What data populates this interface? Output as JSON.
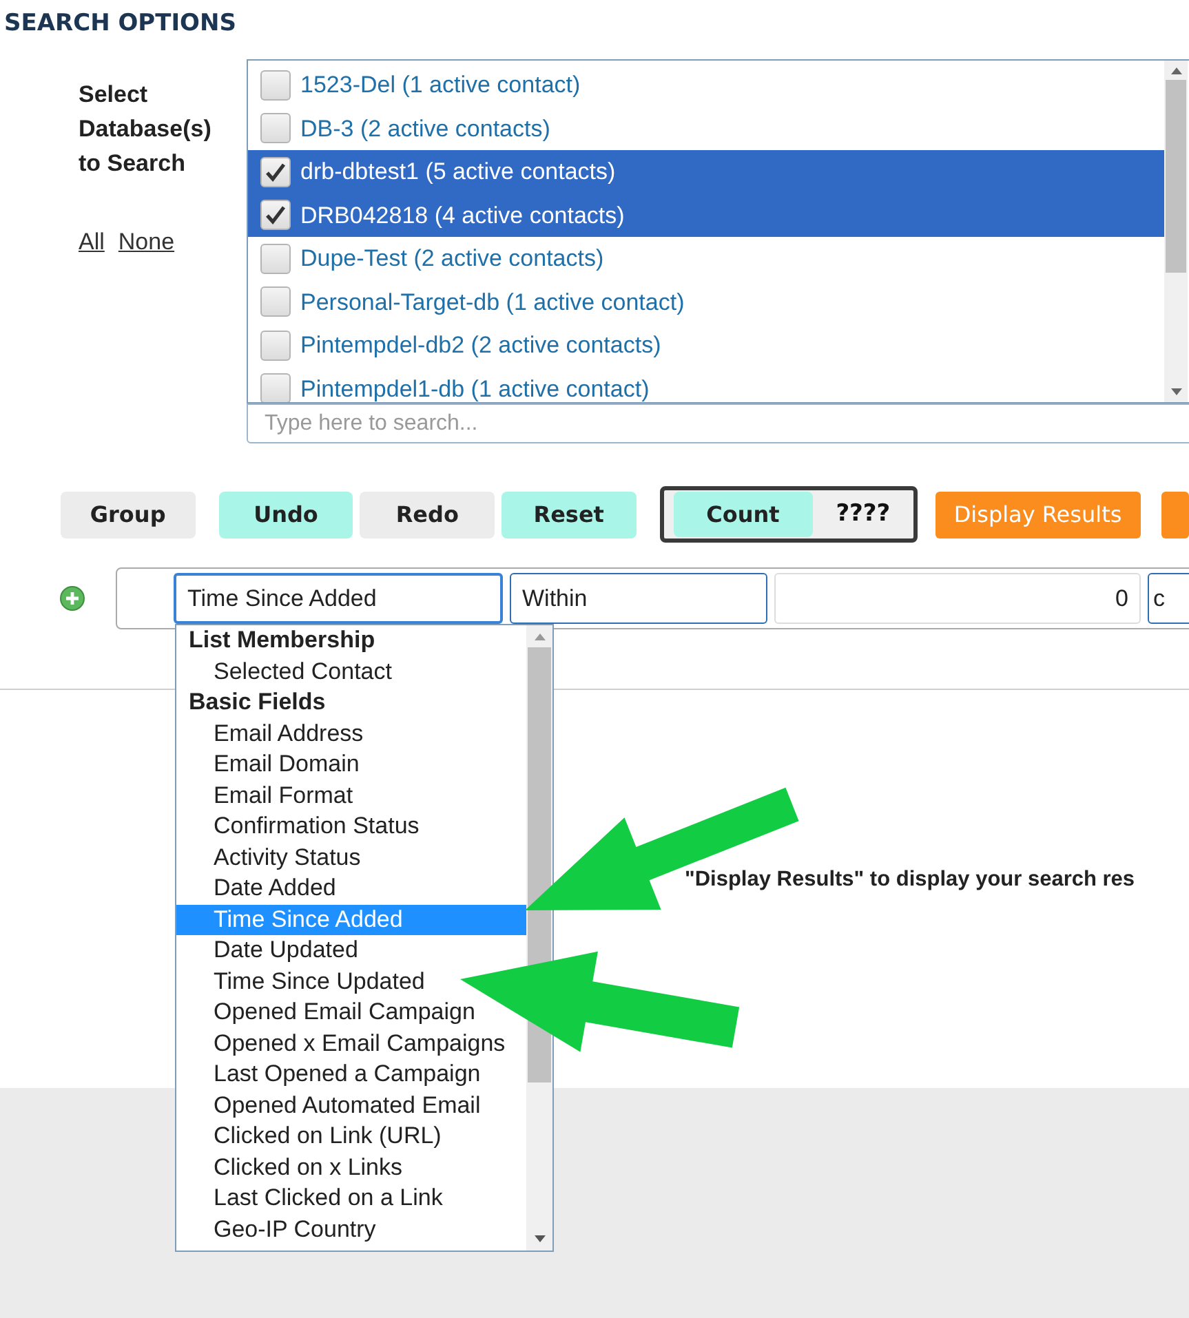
{
  "section_title": "SEARCH OPTIONS",
  "database_picker": {
    "label": "Select Database(s) to Search",
    "links": [
      "All",
      "None"
    ],
    "items": [
      {
        "label": "1523-Del (1 active contact)",
        "checked": false
      },
      {
        "label": "DB-3 (2 active contacts)",
        "checked": false
      },
      {
        "label": "drb-dbtest1 (5 active contacts)",
        "checked": true
      },
      {
        "label": "DRB042818 (4 active contacts)",
        "checked": true
      },
      {
        "label": "Dupe-Test (2 active contacts)",
        "checked": false
      },
      {
        "label": "Personal-Target-db (1 active contact)",
        "checked": false
      },
      {
        "label": "Pintempdel-db2 (2 active contacts)",
        "checked": false
      },
      {
        "label": "Pintempdel1-db (1 active contact)",
        "checked": false
      }
    ],
    "search": {
      "placeholder": "Type here to search..."
    }
  },
  "toolbar": {
    "buttons": [
      {
        "label": "Group",
        "kind": "plain"
      },
      {
        "label": "Undo",
        "kind": "accent"
      },
      {
        "label": "Redo",
        "kind": "plain"
      },
      {
        "label": "Reset",
        "kind": "accent"
      }
    ],
    "count": {
      "label": "Count",
      "value": "????"
    },
    "actions": [
      "Display Results"
    ]
  },
  "criteria_row": {
    "field": "Time Since Added",
    "operator": "Within",
    "amount": "0",
    "unit": "c"
  },
  "field_dropdown": {
    "groups": [
      {
        "label": "List Membership",
        "options": [
          {
            "label": "Selected Contact",
            "selected": false
          }
        ]
      },
      {
        "label": "Basic Fields",
        "options": [
          {
            "label": "Email Address",
            "selected": false
          },
          {
            "label": "Email Domain",
            "selected": false
          },
          {
            "label": "Email Format",
            "selected": false
          },
          {
            "label": "Confirmation Status",
            "selected": false
          },
          {
            "label": "Activity Status",
            "selected": false
          },
          {
            "label": "Date Added",
            "selected": false
          },
          {
            "label": "Time Since Added",
            "selected": true
          },
          {
            "label": "Date Updated",
            "selected": false
          },
          {
            "label": "Time Since Updated",
            "selected": false
          },
          {
            "label": "Opened Email Campaign",
            "selected": false
          },
          {
            "label": "Opened x Email Campaigns",
            "selected": false
          },
          {
            "label": "Last Opened a Campaign",
            "selected": false
          },
          {
            "label": "Opened Automated Email",
            "selected": false
          },
          {
            "label": "Clicked on Link (URL)",
            "selected": false
          },
          {
            "label": "Clicked on x Links",
            "selected": false
          },
          {
            "label": "Last Clicked on a Link",
            "selected": false
          },
          {
            "label": "Geo-IP Country",
            "selected": false
          }
        ]
      }
    ]
  },
  "results_hint": "\"Display Results\" to display your search res"
}
